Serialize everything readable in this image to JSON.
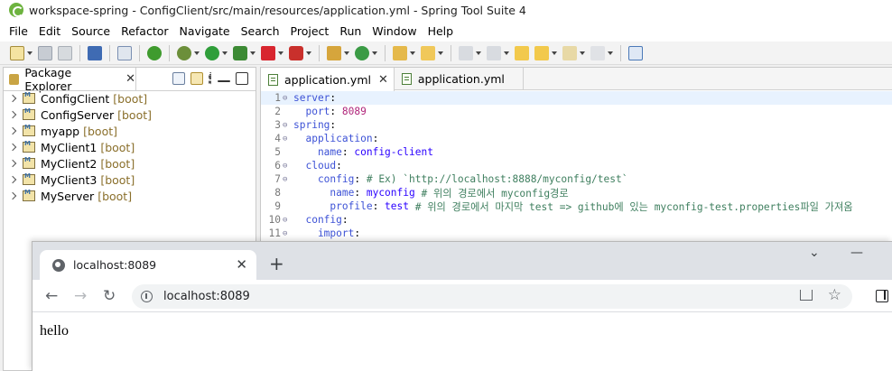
{
  "ide": {
    "title": "workspace-spring - ConfigClient/src/main/resources/application.yml - Spring Tool Suite 4",
    "menu": [
      "File",
      "Edit",
      "Source",
      "Refactor",
      "Navigate",
      "Search",
      "Project",
      "Run",
      "Window",
      "Help"
    ],
    "explorer": {
      "tab_label": "Package Explorer",
      "projects": [
        {
          "name": "ConfigClient",
          "tag": "[boot]"
        },
        {
          "name": "ConfigServer",
          "tag": "[boot]"
        },
        {
          "name": "myapp",
          "tag": "[boot]"
        },
        {
          "name": "MyClient1",
          "tag": "[boot]"
        },
        {
          "name": "MyClient2",
          "tag": "[boot]"
        },
        {
          "name": "MyClient3",
          "tag": "[boot]"
        },
        {
          "name": "MyServer",
          "tag": "[boot]"
        }
      ]
    },
    "editor": {
      "tabs": [
        {
          "label": "application.yml",
          "active": true
        },
        {
          "label": "application.yml",
          "active": false
        }
      ],
      "lines": [
        {
          "n": "1",
          "fold": "⊖",
          "parts": [
            {
              "t": "server",
              "c": "key"
            },
            {
              "t": ":",
              "c": "plain"
            }
          ]
        },
        {
          "n": "2",
          "fold": "",
          "parts": [
            {
              "t": "  port",
              "c": "key"
            },
            {
              "t": ": ",
              "c": "plain"
            },
            {
              "t": "8089",
              "c": "num"
            }
          ]
        },
        {
          "n": "3",
          "fold": "⊖",
          "parts": [
            {
              "t": "spring",
              "c": "key"
            },
            {
              "t": ":",
              "c": "plain"
            }
          ]
        },
        {
          "n": "4",
          "fold": "⊖",
          "parts": [
            {
              "t": "  application",
              "c": "key"
            },
            {
              "t": ":",
              "c": "plain"
            }
          ]
        },
        {
          "n": "5",
          "fold": "",
          "parts": [
            {
              "t": "    name",
              "c": "key"
            },
            {
              "t": ": ",
              "c": "plain"
            },
            {
              "t": "config-client",
              "c": "val"
            }
          ]
        },
        {
          "n": "6",
          "fold": "⊖",
          "parts": [
            {
              "t": "  cloud",
              "c": "key"
            },
            {
              "t": ":",
              "c": "plain"
            }
          ]
        },
        {
          "n": "7",
          "fold": "⊖",
          "parts": [
            {
              "t": "    config",
              "c": "key"
            },
            {
              "t": ": ",
              "c": "plain"
            },
            {
              "t": "# Ex) `http://localhost:8888/myconfig/test`",
              "c": "comment"
            }
          ]
        },
        {
          "n": "8",
          "fold": "",
          "parts": [
            {
              "t": "      name",
              "c": "key"
            },
            {
              "t": ": ",
              "c": "plain"
            },
            {
              "t": "myconfig ",
              "c": "val"
            },
            {
              "t": "# 위의 경로에서 myconfig경로",
              "c": "comment"
            }
          ]
        },
        {
          "n": "9",
          "fold": "",
          "parts": [
            {
              "t": "      profile",
              "c": "key"
            },
            {
              "t": ": ",
              "c": "plain"
            },
            {
              "t": "test ",
              "c": "val"
            },
            {
              "t": "# 위의 경로에서 마지막 test => github에 있는 myconfig-test.properties파일 가져옴",
              "c": "comment"
            }
          ]
        },
        {
          "n": "10",
          "fold": "⊖",
          "parts": [
            {
              "t": "  config",
              "c": "key"
            },
            {
              "t": ":",
              "c": "plain"
            }
          ]
        },
        {
          "n": "11",
          "fold": "⊖",
          "parts": [
            {
              "t": "    import",
              "c": "key"
            },
            {
              "t": ":",
              "c": "plain"
            }
          ]
        }
      ]
    }
  },
  "browser": {
    "tab_title": "localhost:8089",
    "new_tab": "+",
    "url": "localhost:8089",
    "body_text": "hello",
    "window_controls": {
      "dropdown": "⌄",
      "minimize": "—"
    }
  },
  "icons": {
    "back": "←",
    "forward": "→",
    "reload": "↻",
    "close": "✕",
    "star": "☆"
  }
}
